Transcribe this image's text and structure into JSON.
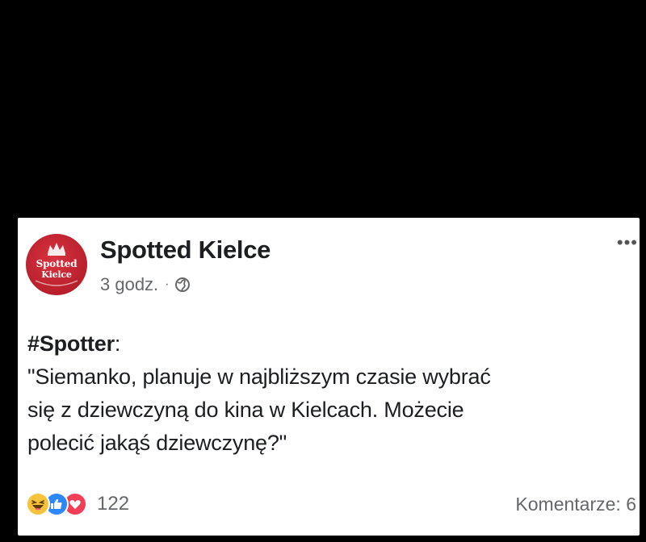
{
  "post": {
    "page_name": "Spotted Kielce",
    "avatar": {
      "line1": "Spotted",
      "line2": "Kielce",
      "color": "#c62a36"
    },
    "time": "3 godz.",
    "separator": "·",
    "privacy_icon": "globe-icon",
    "more_label": "•••",
    "hashtag": "#Spotter",
    "hashtag_suffix": ":",
    "body_lines": [
      "\"Siemanko, planuje w najbliższym czasie wybrać",
      "się z dziewczyną do kina w Kielcach. Możecie",
      "polecić jakąś dziewczynę?\""
    ]
  },
  "footer": {
    "reaction_icons": [
      "haha-icon",
      "like-icon",
      "love-icon"
    ],
    "reaction_count": "122",
    "comments_label": "Komentarze: 6"
  },
  "colors": {
    "background": "#000000",
    "card": "#ffffff",
    "text": "#1c1e21",
    "secondary": "#65676b",
    "like": "#2d88ff",
    "love": "#f33e58",
    "haha": "#f7c33b"
  }
}
